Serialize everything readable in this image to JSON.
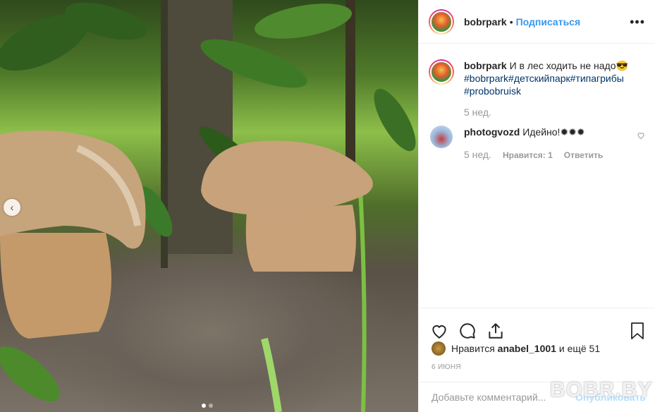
{
  "post": {
    "username": "bobrpark",
    "follow_label": "Подписаться",
    "caption_text": "И в лес ходить не надо😎",
    "hashtags": [
      "#bobrpark",
      "#детскийпарк",
      "#типагрибы",
      "#probobruisk"
    ],
    "caption_time": "5 нед."
  },
  "comment": {
    "username": "photogvozd",
    "text": "Идейно!✹✹✹",
    "time": "5 нед.",
    "likes_label": "Нравится: 1",
    "reply_label": "Ответить"
  },
  "likes": {
    "prefix": "Нравится",
    "user": "anabel_1001",
    "suffix": "и ещё 51"
  },
  "date": "6 ИЮНЯ",
  "add_comment": {
    "placeholder": "Добавьте комментарий...",
    "publish_label": "Опубликовать"
  },
  "watermark": "BOBR.BY",
  "icons": {
    "more": "more-dots-icon",
    "heart": "heart-icon",
    "comment": "comment-icon",
    "share": "share-icon",
    "bookmark": "bookmark-icon",
    "carousel_prev": "chevron-left-icon"
  },
  "colors": {
    "link": "#3897f0",
    "hashtag": "#003569",
    "muted": "#999999",
    "publish_disabled": "#b2dffc"
  },
  "carousel": {
    "total": 2,
    "active": 1
  }
}
